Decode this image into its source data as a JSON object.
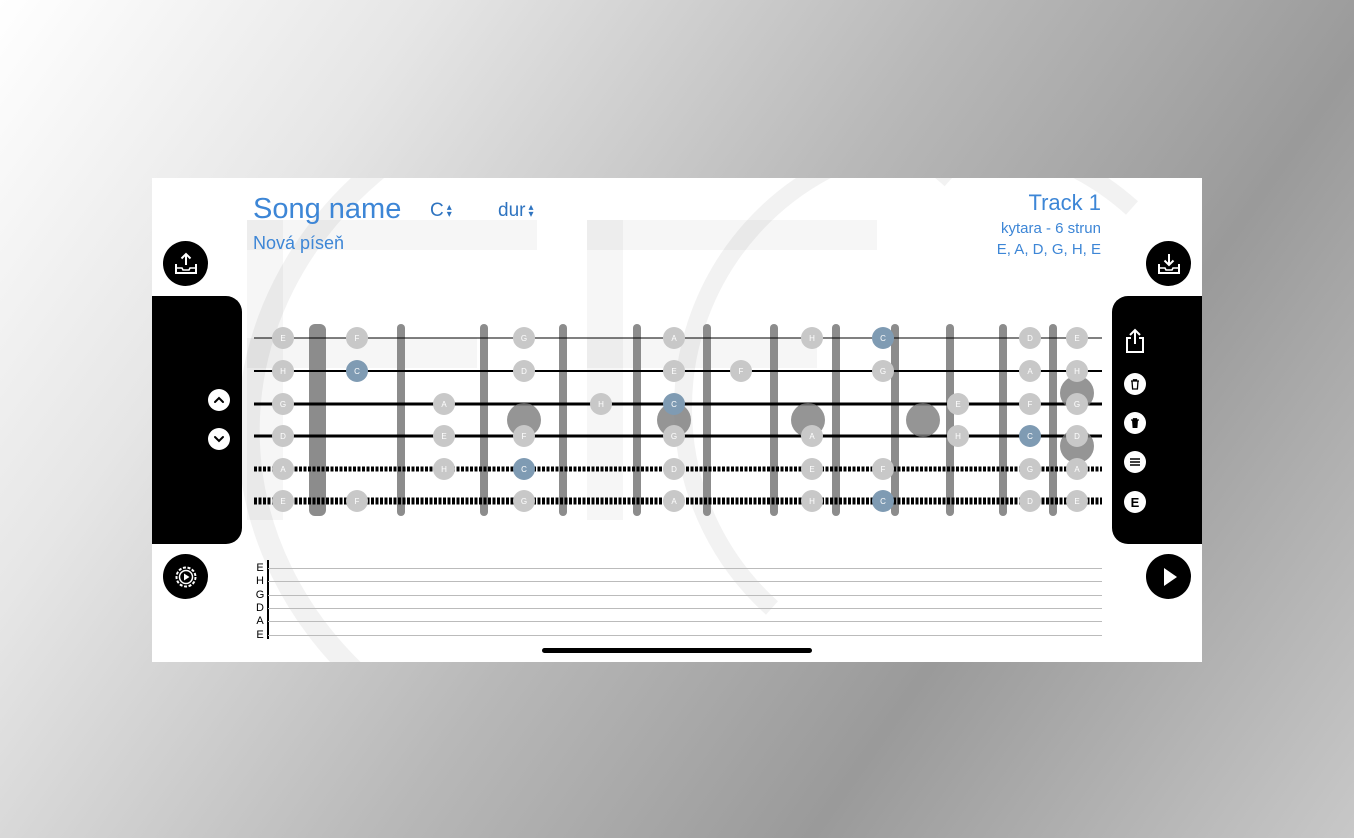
{
  "song": {
    "title": "Song name",
    "subtitle": "Nová píseň",
    "key": "C",
    "scale": "dur"
  },
  "track": {
    "title": "Track 1",
    "instrument": "kytara - 6 strun",
    "tuning": "E, A, D, G, H, E"
  },
  "colors": {
    "accent": "#3d86d6",
    "note_default": "#c8c8c8",
    "note_root": "#7f9bb3",
    "fret": "#8c8c8c",
    "panel": "#000000"
  },
  "icons": {
    "import": "tray-arrow-up-icon",
    "export": "tray-arrow-down-icon",
    "scroll_up": "chevron-up-icon",
    "scroll_down": "chevron-down-icon",
    "share": "share-icon",
    "delete_all": "trash-circle-icon",
    "delete": "trash-icon",
    "menu": "list-icon",
    "string_mode": "E",
    "settings": "gear-play-icon",
    "play": "play-icon"
  },
  "string_mode_label": "E",
  "fretboard": {
    "string_names": [
      "E",
      "H",
      "G",
      "D",
      "A",
      "E"
    ],
    "frets": 16,
    "notes": [
      {
        "s": 0,
        "f": 0,
        "n": "E"
      },
      {
        "s": 0,
        "f": 1,
        "n": "F"
      },
      {
        "s": 0,
        "f": 3,
        "n": "G"
      },
      {
        "s": 0,
        "f": 5,
        "n": "A"
      },
      {
        "s": 0,
        "f": 7,
        "n": "H"
      },
      {
        "s": 0,
        "f": 8,
        "n": "C",
        "r": true
      },
      {
        "s": 0,
        "f": 10,
        "n": "D"
      },
      {
        "s": 0,
        "f": 12,
        "n": "E"
      },
      {
        "s": 1,
        "f": 0,
        "n": "H"
      },
      {
        "s": 1,
        "f": 1,
        "n": "C",
        "r": true
      },
      {
        "s": 1,
        "f": 3,
        "n": "D"
      },
      {
        "s": 1,
        "f": 5,
        "n": "E"
      },
      {
        "s": 1,
        "f": 6,
        "n": "F"
      },
      {
        "s": 1,
        "f": 8,
        "n": "G"
      },
      {
        "s": 1,
        "f": 10,
        "n": "A"
      },
      {
        "s": 1,
        "f": 12,
        "n": "H"
      },
      {
        "s": 2,
        "f": 0,
        "n": "G"
      },
      {
        "s": 2,
        "f": 2,
        "n": "A"
      },
      {
        "s": 2,
        "f": 4,
        "n": "H"
      },
      {
        "s": 2,
        "f": 5,
        "n": "C",
        "r": true
      },
      {
        "s": 2,
        "f": 9,
        "n": "E"
      },
      {
        "s": 2,
        "f": 10,
        "n": "F"
      },
      {
        "s": 2,
        "f": 12,
        "n": "G"
      },
      {
        "s": 3,
        "f": 0,
        "n": "D"
      },
      {
        "s": 3,
        "f": 2,
        "n": "E"
      },
      {
        "s": 3,
        "f": 3,
        "n": "F"
      },
      {
        "s": 3,
        "f": 5,
        "n": "G"
      },
      {
        "s": 3,
        "f": 7,
        "n": "A"
      },
      {
        "s": 3,
        "f": 9,
        "n": "H"
      },
      {
        "s": 3,
        "f": 10,
        "n": "C",
        "r": true
      },
      {
        "s": 3,
        "f": 12,
        "n": "D"
      },
      {
        "s": 4,
        "f": 0,
        "n": "A"
      },
      {
        "s": 4,
        "f": 2,
        "n": "H"
      },
      {
        "s": 4,
        "f": 3,
        "n": "C",
        "r": true
      },
      {
        "s": 4,
        "f": 5,
        "n": "D"
      },
      {
        "s": 4,
        "f": 7,
        "n": "E"
      },
      {
        "s": 4,
        "f": 8,
        "n": "F"
      },
      {
        "s": 4,
        "f": 10,
        "n": "G"
      },
      {
        "s": 4,
        "f": 12,
        "n": "A"
      },
      {
        "s": 5,
        "f": 0,
        "n": "E"
      },
      {
        "s": 5,
        "f": 1,
        "n": "F"
      },
      {
        "s": 5,
        "f": 3,
        "n": "G"
      },
      {
        "s": 5,
        "f": 5,
        "n": "A"
      },
      {
        "s": 5,
        "f": 7,
        "n": "H"
      },
      {
        "s": 5,
        "f": 8,
        "n": "C",
        "r": true
      },
      {
        "s": 5,
        "f": 10,
        "n": "D"
      },
      {
        "s": 5,
        "f": 12,
        "n": "E"
      }
    ],
    "markers": [
      {
        "between": [
          2.5,
          3.5
        ],
        "at": 3
      },
      {
        "between": [
          2.5,
          3.5
        ],
        "at": 5
      },
      {
        "between": [
          2.5,
          3.5
        ],
        "at": 7
      },
      {
        "between": [
          2.5,
          3.5
        ],
        "at": 9
      },
      {
        "between": [
          2,
          3
        ],
        "at": 12
      },
      {
        "between": [
          3,
          4
        ],
        "at": 12
      }
    ]
  },
  "tab_staff": {
    "string_labels": [
      "E",
      "H",
      "G",
      "D",
      "A",
      "E"
    ]
  }
}
